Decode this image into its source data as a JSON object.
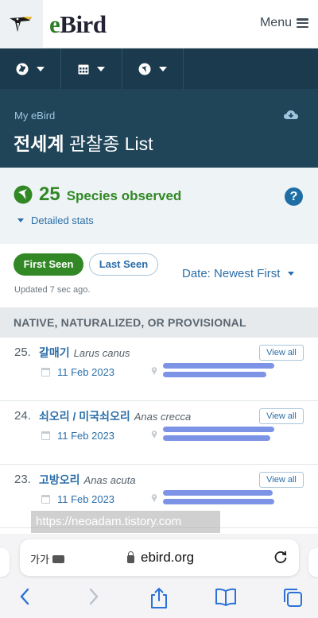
{
  "header": {
    "logo_e": "e",
    "logo_rest": "Bird",
    "menu_label": "Menu"
  },
  "nav": {
    "items": [
      "globe-icon",
      "calendar-icon",
      "species-icon"
    ]
  },
  "hero": {
    "breadcrumb": "My eBird",
    "title_bold": "전세계",
    "title_rest": " 관찰종 List"
  },
  "stats": {
    "count": "25",
    "label": "Species observed",
    "help": "?",
    "detailed_link": "Detailed stats"
  },
  "sort": {
    "first_seen": "First Seen",
    "last_seen": "Last Seen",
    "date_order": "Date: Newest First",
    "updated": "Updated 7 sec ago."
  },
  "section_header": "NATIVE, NATURALIZED, OR PROVISIONAL",
  "rows": [
    {
      "num": "25.",
      "name": "갈매기",
      "sci": "Larus canus",
      "date": "11 Feb 2023",
      "view_all": "View all"
    },
    {
      "num": "24.",
      "name": "쇠오리 / 미국쇠오리",
      "sci": "Anas crecca",
      "date": "11 Feb 2023",
      "view_all": "View all"
    },
    {
      "num": "23.",
      "name": "고방오리",
      "sci": "Anas acuta",
      "date": "11 Feb 2023",
      "view_all": "View all"
    }
  ],
  "watermark": "https://neoadam.tistory.com",
  "browser": {
    "text_size": "가가",
    "url": "ebird.org"
  },
  "colors": {
    "brand_green": "#318825",
    "nav_dark": "#1c3a4d",
    "hero": "#204559",
    "link_blue": "#2b6ea8"
  }
}
